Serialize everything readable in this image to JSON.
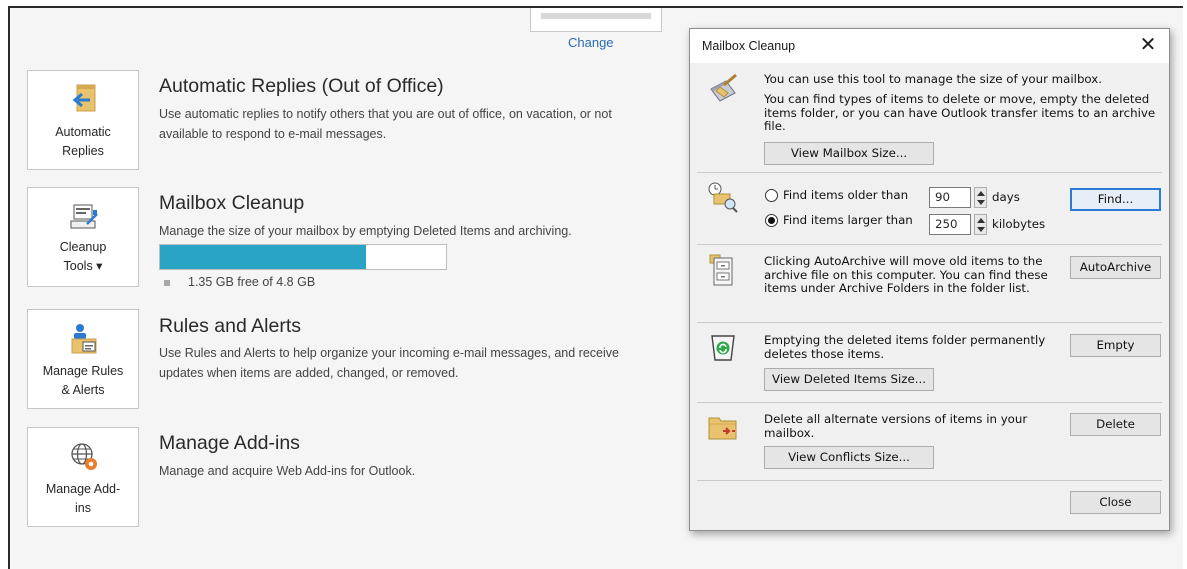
{
  "backstage": {
    "change_link": "Change",
    "tiles": {
      "auto_replies": [
        "Automatic",
        "Replies"
      ],
      "cleanup_tools": [
        "Cleanup",
        "Tools ▾"
      ],
      "manage_rules": [
        "Manage Rules",
        "& Alerts"
      ],
      "manage_addins": [
        "Manage Add-",
        "ins"
      ]
    },
    "sections": {
      "auto_replies": {
        "title": "Automatic Replies (Out of Office)",
        "desc": "Use automatic replies to notify others that you are out of office, on vacation, or not available to respond to e-mail messages."
      },
      "mailbox_cleanup": {
        "title": "Mailbox Cleanup",
        "desc": "Manage the size of your mailbox by emptying Deleted Items and archiving.",
        "storage_text": "1.35 GB free of 4.8 GB",
        "storage_used_fraction": 0.72
      },
      "rules": {
        "title": "Rules and Alerts",
        "desc": "Use Rules and Alerts to help organize your incoming e-mail messages, and receive updates when items are added, changed, or removed."
      },
      "addins": {
        "title": "Manage Add-ins",
        "desc": "Manage and acquire Web Add-ins for Outlook."
      }
    }
  },
  "dialog": {
    "title": "Mailbox Cleanup",
    "close_glyph": "✕",
    "intro_line1": "You can use this tool to manage the size of your mailbox.",
    "intro_line2": "You can find types of items to delete or move, empty the deleted items folder, or you can have Outlook transfer items to an archive file.",
    "view_mailbox_size": "View Mailbox Size...",
    "find": {
      "older_label": "Find items older than",
      "older_value": "90",
      "older_unit": "days",
      "larger_label": "Find items larger than",
      "larger_value": "250",
      "larger_unit": "kilobytes",
      "selected": "larger",
      "find_button": "Find..."
    },
    "autoarchive": {
      "text": "Clicking AutoArchive will move old items to the archive file on this computer. You can find these items under Archive Folders in the folder list.",
      "button": "AutoArchive"
    },
    "deleted": {
      "text": "Emptying the deleted items folder permanently deletes those items.",
      "button": "Empty",
      "view_button": "View Deleted Items Size..."
    },
    "conflicts": {
      "text": "Delete all alternate versions of items in your mailbox.",
      "button": "Delete",
      "view_button": "View Conflicts Size..."
    },
    "close_button": "Close"
  },
  "colors": {
    "storage_fill": "#2aa4c4",
    "link": "#2b6cb0",
    "default_button_border": "#2b7bd6"
  }
}
